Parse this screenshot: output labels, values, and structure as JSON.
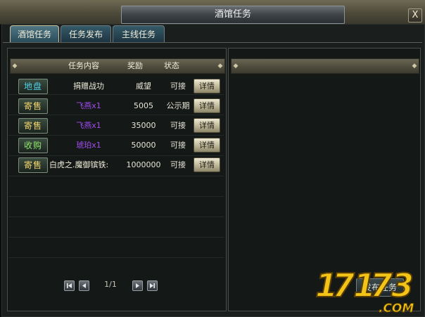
{
  "window": {
    "title": "酒馆任务",
    "close_label": "X"
  },
  "tabs": [
    {
      "label": "酒馆任务",
      "active": true
    },
    {
      "label": "任务发布",
      "active": false
    },
    {
      "label": "主线任务",
      "active": false
    }
  ],
  "table": {
    "headers": {
      "content": "任务内容",
      "reward": "奖励",
      "status": "状态"
    },
    "rows": [
      {
        "category": "地盘",
        "category_color": "#4fd0e8",
        "content": "捐赠战功",
        "content_color": "#f0ecd9",
        "reward": "威望",
        "status": "可接",
        "detail_label": "详情"
      },
      {
        "category": "寄售",
        "category_color": "#f2d56b",
        "content": "飞燕x1",
        "content_color": "#a24cf0",
        "reward": "5005",
        "status": "公示期",
        "detail_label": "详情"
      },
      {
        "category": "寄售",
        "category_color": "#f2d56b",
        "content": "飞燕x1",
        "content_color": "#a24cf0",
        "reward": "35000",
        "status": "可接",
        "detail_label": "详情"
      },
      {
        "category": "收购",
        "category_color": "#8fe86b",
        "content": "琥珀x1",
        "content_color": "#a24cf0",
        "reward": "50000",
        "status": "可接",
        "detail_label": "详情"
      },
      {
        "category": "寄售",
        "category_color": "#f2d56b",
        "content": "白虎之.魔御镔铁:",
        "content_color": "#f0ecd9",
        "reward": "1000000",
        "status": "可接",
        "detail_label": "详情"
      }
    ]
  },
  "pagination": {
    "page_text": "1/1",
    "icons": [
      "first-page-icon",
      "prev-page-icon",
      "next-page-icon",
      "last-page-icon"
    ]
  },
  "right_panel": {
    "publish_label": "发布任务"
  },
  "watermark": {
    "text": "17173.COM"
  }
}
